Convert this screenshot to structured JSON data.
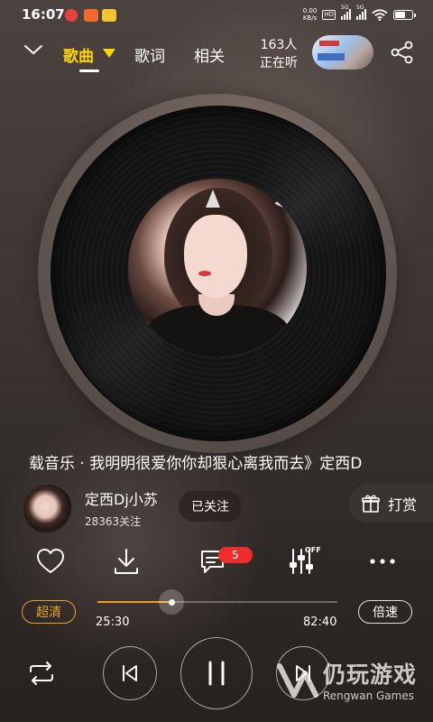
{
  "status_bar": {
    "time": "16:07",
    "net_speed_value": "0.00",
    "net_speed_unit": "KB/s",
    "hd_label": "HD",
    "network_1": "5G",
    "network_2": "5G",
    "battery_level": 0.6
  },
  "header": {
    "tabs": [
      {
        "label": "歌曲",
        "active": true
      },
      {
        "label": "歌词",
        "active": false
      },
      {
        "label": "相关",
        "active": false
      }
    ],
    "listeners_count": "163人",
    "listeners_label": "正在听"
  },
  "player": {
    "song_marquee": "载音乐 · 我明明很爱你你却狠心离我而去》定西D",
    "artist": {
      "name": "定西Dj小苏",
      "followers": "28363关注",
      "follow_status": "已关注"
    },
    "reward_label": "打赏",
    "comments_badge": "5",
    "effects_state": "OFF",
    "quality_label": "超清",
    "speed_label": "倍速",
    "current_time": "25:30",
    "total_time": "82:40",
    "progress_fraction": 0.31
  },
  "watermark": {
    "cn": "仍玩游戏",
    "en": "Rengwan Games"
  },
  "icons": {
    "back": "chevron-down-icon",
    "share": "share-icon",
    "like": "heart-icon",
    "download": "download-icon",
    "comments": "comment-icon",
    "effects": "equalizer-icon",
    "more": "more-icon",
    "loop": "loop-icon",
    "prev": "previous-icon",
    "pause": "pause-icon",
    "next": "next-icon",
    "gift": "gift-icon"
  },
  "colors": {
    "accent_yellow": "#ffd400",
    "accent_orange": "#f0a020",
    "badge_red": "#f02c2c"
  }
}
